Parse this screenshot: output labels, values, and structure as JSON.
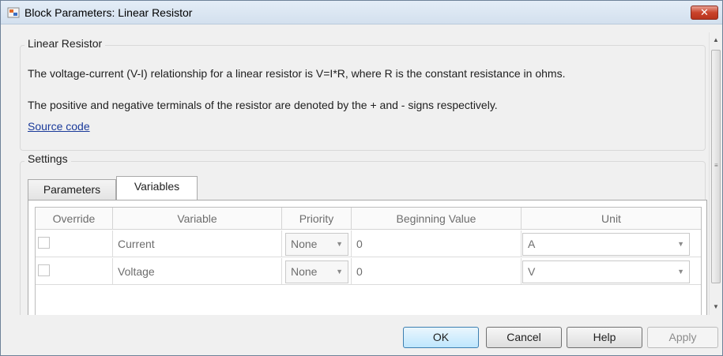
{
  "window": {
    "title": "Block Parameters: Linear Resistor",
    "close_label": "✕"
  },
  "block": {
    "group_title": "Linear Resistor",
    "description_line1": "The voltage-current (V-I) relationship for a linear resistor is V=I*R, where R is the constant resistance in ohms.",
    "description_line2": "The positive and negative terminals of the resistor are denoted by the + and - signs respectively.",
    "source_link": "Source code"
  },
  "settings": {
    "group_title": "Settings",
    "tabs": [
      {
        "label": "Parameters",
        "active": false
      },
      {
        "label": "Variables",
        "active": true
      }
    ],
    "table": {
      "headers": [
        "Override",
        "Variable",
        "Priority",
        "Beginning Value",
        "Unit"
      ],
      "rows": [
        {
          "override": false,
          "variable": "Current",
          "priority": "None",
          "beginning_value": "0",
          "unit": "A"
        },
        {
          "override": false,
          "variable": "Voltage",
          "priority": "None",
          "beginning_value": "0",
          "unit": "V"
        }
      ]
    }
  },
  "buttons": {
    "ok": "OK",
    "cancel": "Cancel",
    "help": "Help",
    "apply": "Apply"
  },
  "icons": {
    "app": "simulink-block-icon",
    "close": "close-icon",
    "dropdown": "chevron-down-icon",
    "scroll_up": "scroll-up-arrow-icon",
    "scroll_down": "scroll-down-arrow-icon"
  },
  "colors": {
    "link": "#1a3a9a",
    "close_button": "#c9432b",
    "default_button": "#bee6fd"
  }
}
